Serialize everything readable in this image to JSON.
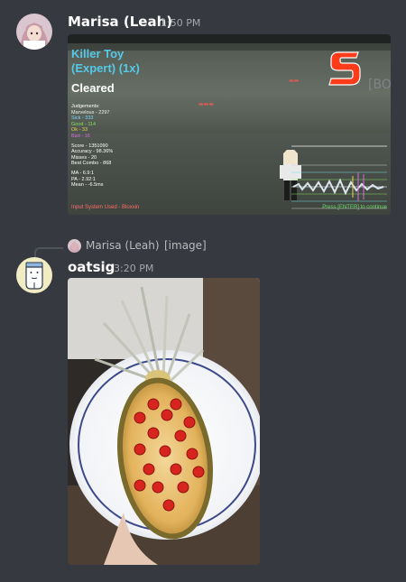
{
  "messages": [
    {
      "author": "Marisa (Leah)",
      "time": "1:50 PM",
      "attachment": {
        "game": {
          "title_line1": "Killer Toy",
          "title_line2": "(Expert) (1x)",
          "status": "Cleared",
          "judgements_label": "Judgements:",
          "judgements": [
            {
              "label": "Marvelous - 2297",
              "cls": "j-mar"
            },
            {
              "label": "Sick - 333",
              "cls": "j-sick"
            },
            {
              "label": "Good - 114",
              "cls": "j-good"
            },
            {
              "label": "Ok - 33",
              "cls": "j-ok"
            },
            {
              "label": "Bad - 16",
              "cls": "j-bad"
            }
          ],
          "score": "Score - 1351090",
          "accuracy": "Accuracy - 98.36%",
          "misses": "Misses - 20",
          "best_combo": "Best Combo - 868",
          "ma": "MA - 6.9:1",
          "pa": "PA - 2.92:1",
          "mean": "Mean - -6.5ms",
          "footer_left": "Input System Used - Bloxxin",
          "footer_right": "Press [ENTER] to continue",
          "logo_letter": "S",
          "bracket_text": "[BO"
        }
      }
    },
    {
      "reply_author": "Marisa (Leah)",
      "reply_content": "[image]",
      "author": "oatsig",
      "time": "3:20 PM"
    }
  ],
  "colors": {
    "background": "#36393f",
    "username": "#ffffff",
    "timestamp": "#a3a6aa",
    "title_cyan": "#56c8e8",
    "footer_red": "#ff6b6b",
    "footer_green": "#6ee06e",
    "logo_red": "#ff3b1a"
  }
}
